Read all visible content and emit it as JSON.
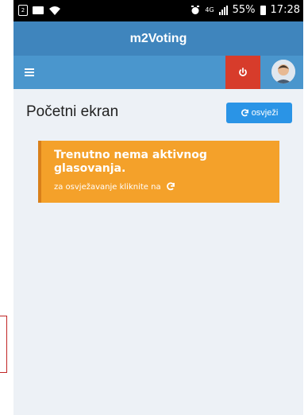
{
  "status_bar": {
    "sim_label": "2",
    "network": "4G",
    "battery": "55%",
    "time": "17:28"
  },
  "header": {
    "title": "m2Voting"
  },
  "nav": {
    "menu_icon": "hamburger-icon",
    "power_icon": "power-icon",
    "avatar": "avatar"
  },
  "main": {
    "title": "Početni ekran",
    "refresh_label": "osvježi"
  },
  "notice": {
    "title": "Trenutno nema aktivnog glasovanja.",
    "subtitle": "za osvježavanje kliknite na"
  },
  "colors": {
    "header": "#3f85bd",
    "nav": "#4a96cd",
    "power": "#d73c2b",
    "notice": "#f4a12a",
    "refresh": "#2a94e6"
  }
}
